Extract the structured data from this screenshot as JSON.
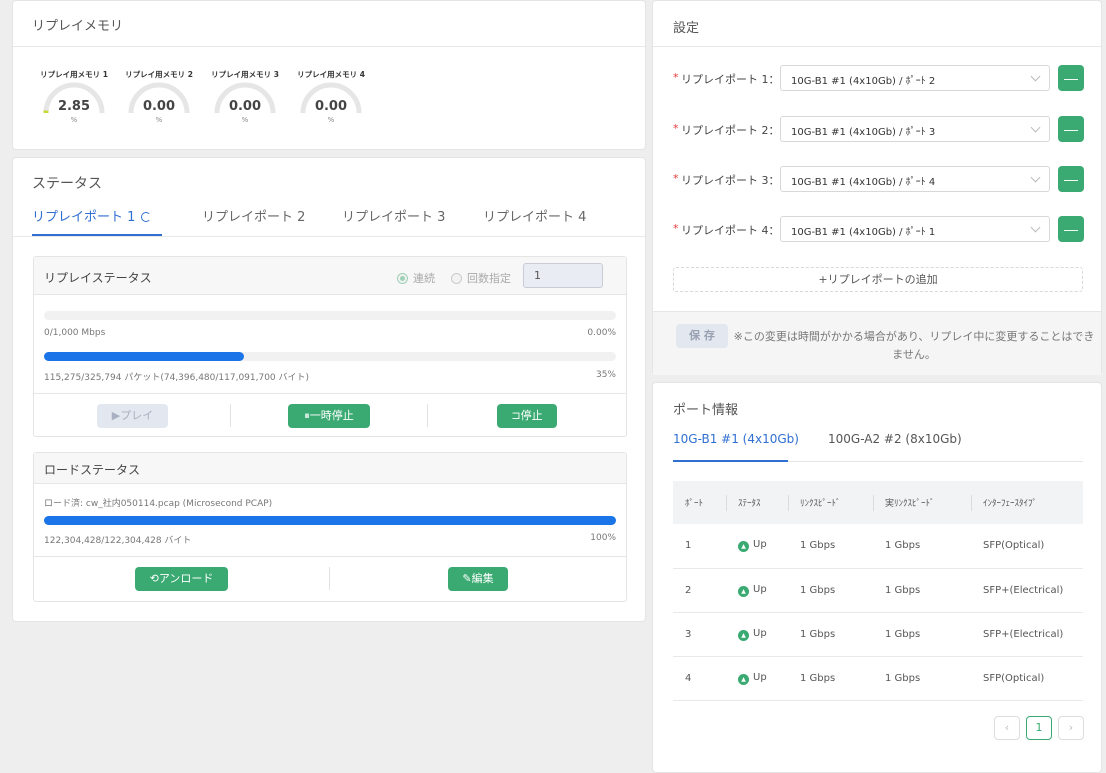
{
  "memory": {
    "title": "リプレイメモリ",
    "gauges": [
      {
        "label": "リプレイ用メモリ 1",
        "value": "2.85",
        "unit": "%",
        "percent": 2.85
      },
      {
        "label": "リプレイ用メモリ 2",
        "value": "0.00",
        "unit": "%",
        "percent": 0
      },
      {
        "label": "リプレイ用メモリ 3",
        "value": "0.00",
        "unit": "%",
        "percent": 0
      },
      {
        "label": "リプレイ用メモリ 4",
        "value": "0.00",
        "unit": "%",
        "percent": 0
      }
    ]
  },
  "status": {
    "title": "ステータス",
    "tabs": [
      "リプレイポート 1",
      "リプレイポート 2",
      "リプレイポート 3",
      "リプレイポート 4"
    ],
    "replay": {
      "title": "リプレイステータス",
      "radio_continuous": "連続",
      "radio_count": "回数指定",
      "count_value": "1",
      "rate_text": "0/1,000 Mbps",
      "rate_percent": "0.00%",
      "rate_fraction": 0,
      "packet_text": "115,275/325,794 パケット(74,396,480/117,091,700 バイト)",
      "packet_percent": "35%",
      "packet_fraction": 0.35,
      "play_button": "▶プレイ",
      "pause_button": "⏸一時停止",
      "stop_button": "⊐停止"
    },
    "load": {
      "title": "ロードステータス",
      "file_text": "ロード済: cw_社内050114.pcap (Microsecond PCAP)",
      "bytes_text": "122,304,428/122,304,428 バイト",
      "percent_text": "100%",
      "fraction": 1.0,
      "unload_button": "アンロード",
      "edit_button": "編集"
    }
  },
  "settings": {
    "title": "設定",
    "rows": [
      {
        "label": "リプレイポート 1：",
        "value": "10G-B1 #1 (4x10Gb) / ﾎﾟｰﾄ 2"
      },
      {
        "label": "リプレイポート 2：",
        "value": "10G-B1 #1 (4x10Gb) / ﾎﾟｰﾄ 3"
      },
      {
        "label": "リプレイポート 3：",
        "value": "10G-B1 #1 (4x10Gb) / ﾎﾟｰﾄ 4"
      },
      {
        "label": "リプレイポート 4：",
        "value": "10G-B1 #1 (4x10Gb) / ﾎﾟｰﾄ 1"
      }
    ],
    "required_mark": "*",
    "minus_label": "—",
    "add_port": "+リプレイポートの追加",
    "save_button": "保 存",
    "note": "※この変更は時間がかかる場合があり、リプレイ中に変更することはできません。"
  },
  "portinfo": {
    "title": "ポート情報",
    "tabs": [
      "10G-B1 #1 (4x10Gb)",
      "100G-A2 #2 (8x10Gb)"
    ],
    "columns": [
      "ﾎﾟｰﾄ",
      "ｽﾃｰﾀｽ",
      "ﾘﾝｸｽﾋﾟｰﾄﾞ",
      "実ﾘﾝｸｽﾋﾟｰﾄﾞ",
      "ｲﾝﾀｰﾌｪｰｽﾀｲﾌﾟ"
    ],
    "rows": [
      {
        "port": "1",
        "status": "Up",
        "link": "1 Gbps",
        "real": "1 Gbps",
        "type": "SFP(Optical)"
      },
      {
        "port": "2",
        "status": "Up",
        "link": "1 Gbps",
        "real": "1 Gbps",
        "type": "SFP+(Electrical)"
      },
      {
        "port": "3",
        "status": "Up",
        "link": "1 Gbps",
        "real": "1 Gbps",
        "type": "SFP+(Electrical)"
      },
      {
        "port": "4",
        "status": "Up",
        "link": "1 Gbps",
        "real": "1 Gbps",
        "type": "SFP(Optical)"
      }
    ],
    "pager": {
      "prev": "‹",
      "current": "1",
      "next": "›"
    }
  },
  "colors": {
    "accent": "#2f6fd1",
    "green": "#3aaa72",
    "progress": "#1b74e8",
    "gauge": "#c8d93a"
  }
}
